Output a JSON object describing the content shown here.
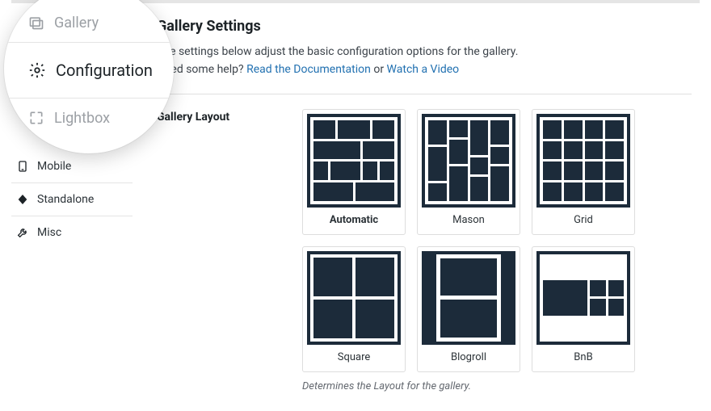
{
  "sidebar": {
    "items": [
      {
        "key": "mobile",
        "label": "Mobile"
      },
      {
        "key": "standalone",
        "label": "Standalone"
      },
      {
        "key": "misc",
        "label": "Misc"
      }
    ]
  },
  "magnifier": {
    "gallery_label": "Gallery",
    "configuration_label": "Configuration",
    "lightbox_label": "Lightbox"
  },
  "main": {
    "heading": "Gallery Settings",
    "desc1": "The settings below adjust the basic configuration options for the gallery.",
    "desc2_pre": "Need some help? ",
    "desc2_link1": "Read the Documentation",
    "desc2_or": " or ",
    "desc2_link2": "Watch a Video",
    "layout_label": "Gallery Layout",
    "helper": "Determines the Layout for the gallery."
  },
  "layouts": {
    "automatic": "Automatic",
    "mason": "Mason",
    "grid": "Grid",
    "square": "Square",
    "blogroll": "Blogroll",
    "bnb": "BnB"
  }
}
